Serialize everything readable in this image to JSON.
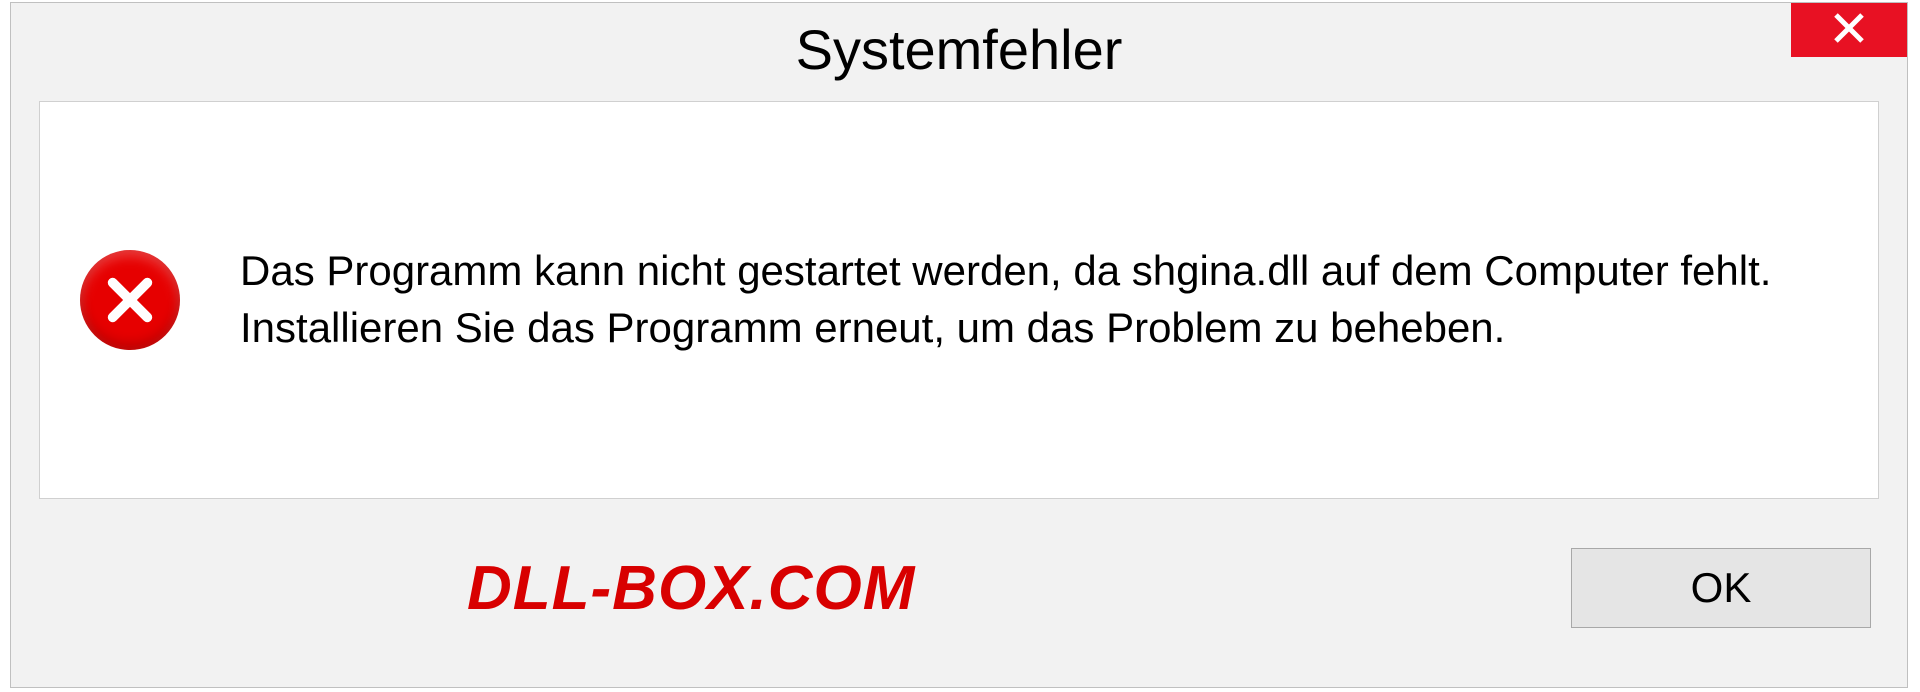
{
  "dialog": {
    "title": "Systemfehler",
    "message": "Das Programm kann nicht gestartet werden, da shgina.dll auf dem Computer fehlt. Installieren Sie das Programm erneut, um das Problem zu beheben.",
    "ok_label": "OK"
  },
  "watermark": "DLL-BOX.COM"
}
